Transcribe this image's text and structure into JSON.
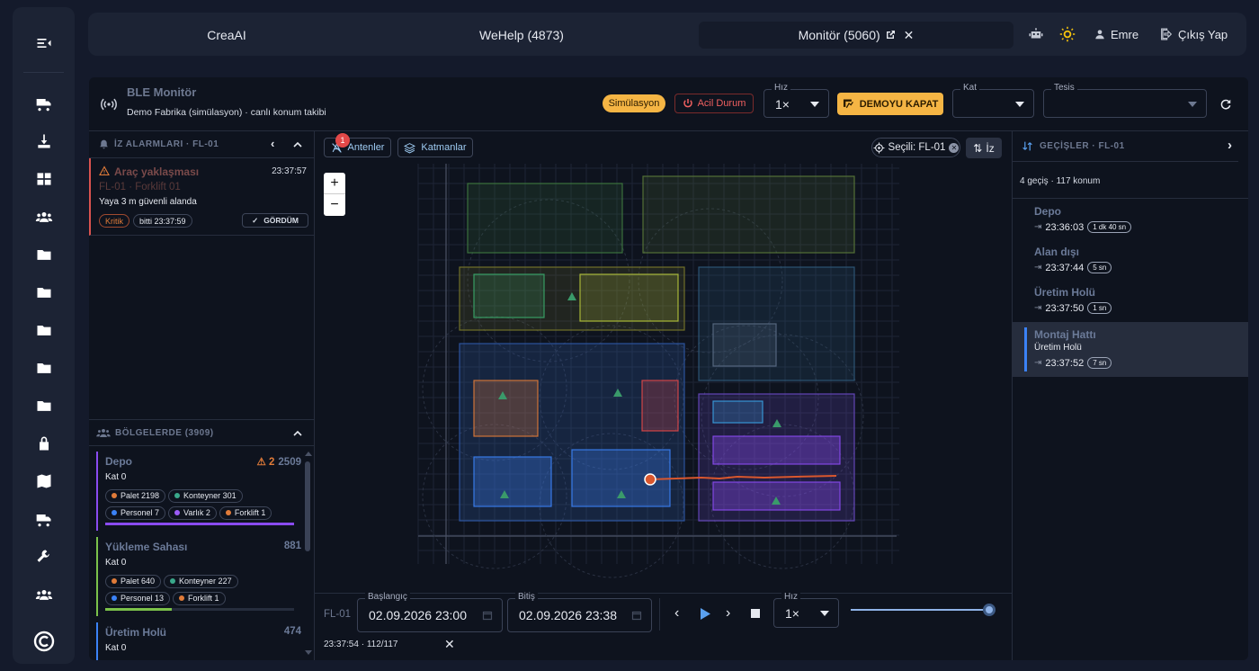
{
  "topbar": {
    "tabs": [
      "CreaAI",
      "WeHelp (4873)",
      "Monitör (5060)"
    ],
    "user": "Emre",
    "logout": "Çıkış Yap"
  },
  "header": {
    "title": "BLE Monitör",
    "subtitle": "Demo Fabrika (simülasyon) · canlı konum takibi",
    "sim_badge": "Simülasyon",
    "emergency": "Acil Durum",
    "speed_label": "Hız",
    "speed_value": "1×",
    "demo_button": "DEMOYU KAPAT",
    "floor_label": "Kat",
    "floor_value": "",
    "facility_label": "Tesis",
    "facility_value": ""
  },
  "alarms": {
    "title": "İZ ALARMLARI · FL-01",
    "item": {
      "title": "Araç yaklaşması",
      "time": "23:37:57",
      "target": "FL-01 · Forklift 01",
      "message": "Yaya 3 m güvenli alanda",
      "severity": "Kritik",
      "ended": "bitti 23:37:59",
      "ack": "GÖRDÜM"
    }
  },
  "zones": {
    "title": "BÖLGELERDE (3909)",
    "items": [
      {
        "name": "Depo",
        "warn": "2",
        "count": "2509",
        "floor": "Kat 0",
        "color": "#8a4bf0",
        "fill": 1.0,
        "chips": [
          [
            "Palet 2198",
            "#e07b39"
          ],
          [
            "Konteyner 301",
            "#3aa88a"
          ],
          [
            "Personel 7",
            "#3b82f6"
          ],
          [
            "Varlık 2",
            "#9b5cf6"
          ],
          [
            "Forklift 1",
            "#e07b39"
          ]
        ]
      },
      {
        "name": "Yükleme Sahası",
        "warn": "",
        "count": "881",
        "floor": "Kat 0",
        "color": "#7bc24a",
        "fill": 0.35,
        "chips": [
          [
            "Palet 640",
            "#e07b39"
          ],
          [
            "Konteyner 227",
            "#3aa88a"
          ],
          [
            "Personel 13",
            "#3b82f6"
          ],
          [
            "Forklift 1",
            "#e07b39"
          ]
        ]
      },
      {
        "name": "Üretim Holü",
        "warn": "",
        "count": "474",
        "floor": "Kat 0",
        "color": "#3b82f6",
        "fill": 0.2,
        "chips": []
      }
    ]
  },
  "map": {
    "antennas": "Antenler",
    "antenna_badge": "1",
    "layers": "Katmanlar",
    "selected": "Seçili: FL-01",
    "trail": "İz",
    "zoom_in": "+",
    "zoom_out": "−"
  },
  "playback": {
    "tag": "FL-01",
    "start_label": "Başlangıç",
    "start_value": "02.09.2026 23:00",
    "end_label": "Bitiş",
    "end_value": "02.09.2026 23:38",
    "speed_label": "Hız",
    "speed_value": "1×",
    "status": "23:37:54 · 112/117",
    "progress": 0.96
  },
  "transitions": {
    "title": "GEÇİŞLER · FL-01",
    "summary": "4 geçiş · 117 konum",
    "items": [
      {
        "name": "Depo",
        "sub": "",
        "time": "23:36:03",
        "dur": "1 dk 40 sn"
      },
      {
        "name": "Alan dışı",
        "sub": "",
        "time": "23:37:44",
        "dur": "5 sn"
      },
      {
        "name": "Üretim Holü",
        "sub": "",
        "time": "23:37:50",
        "dur": "1 sn"
      },
      {
        "name": "Montaj Hattı",
        "sub": "Üretim Holü",
        "time": "23:37:52",
        "dur": "7 sn"
      }
    ]
  }
}
